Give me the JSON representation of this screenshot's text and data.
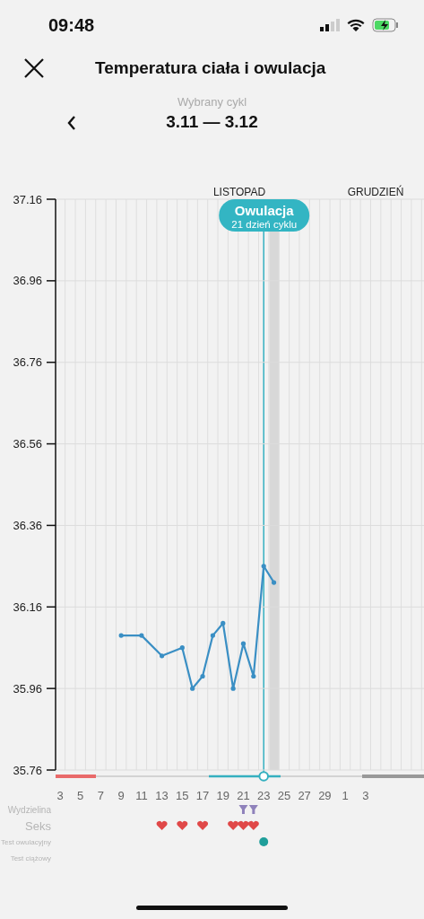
{
  "status_bar": {
    "time": "09:48"
  },
  "header": {
    "title": "Temperatura ciała i owulacja"
  },
  "cycle": {
    "label": "Wybrany cykl",
    "range": "3.11 — 3.12"
  },
  "months": [
    "LISTOPAD",
    "GRUDZIEŃ"
  ],
  "ovulation": {
    "title": "Owulacja",
    "subtitle": "21 dzień cyklu"
  },
  "chart_data": {
    "type": "line",
    "categories": [
      "3",
      null,
      "5",
      null,
      "7",
      null,
      "9",
      null,
      "11",
      null,
      "13",
      null,
      "15",
      null,
      "17",
      null,
      "19",
      null,
      "21",
      null,
      "23",
      null,
      "25",
      null,
      "27",
      null,
      "29",
      null,
      "1",
      null,
      "3"
    ],
    "series": [
      {
        "color": "#3a8fc4",
        "values": [
          null,
          null,
          null,
          null,
          null,
          null,
          36.09,
          null,
          36.09,
          null,
          36.04,
          null,
          36.06,
          35.96,
          35.99,
          36.09,
          36.12,
          35.96,
          36.07,
          35.99,
          36.26,
          36.22,
          null,
          null,
          null,
          null,
          null,
          null,
          null,
          null,
          null
        ]
      }
    ],
    "ylim": [
      35.76,
      37.16
    ],
    "grid": true,
    "yticks": [
      {
        "value": 37.16,
        "label": "37.16"
      },
      {
        "value": 36.96,
        "label": "36.96"
      },
      {
        "value": 36.76,
        "label": "36.76"
      },
      {
        "value": 36.56,
        "label": "36.56"
      },
      {
        "value": 36.36,
        "label": "36.36"
      },
      {
        "value": 36.16,
        "label": "36.16"
      },
      {
        "value": 35.96,
        "label": "35.96"
      },
      {
        "value": 35.76,
        "label": "35.76"
      }
    ]
  },
  "events": [
    {
      "label": "Wydzielina",
      "kind": "discharge",
      "marks": [
        false,
        false,
        false,
        false,
        false,
        false,
        false,
        false,
        false,
        false,
        false,
        false,
        false,
        false,
        false,
        false,
        false,
        false,
        true,
        true,
        false,
        false,
        false,
        false,
        false,
        false,
        false,
        false,
        false,
        false,
        false
      ]
    },
    {
      "label": "Seks",
      "kind": "heart",
      "marks": [
        false,
        false,
        false,
        false,
        false,
        false,
        false,
        false,
        false,
        false,
        true,
        false,
        true,
        false,
        true,
        false,
        false,
        true,
        true,
        true,
        false,
        false,
        false,
        false,
        false,
        false,
        false,
        false,
        false,
        false,
        false
      ]
    },
    {
      "label": "Test owulacyjny",
      "kind": "dot",
      "marks": [
        false,
        false,
        false,
        false,
        false,
        false,
        false,
        false,
        false,
        false,
        false,
        false,
        false,
        false,
        false,
        false,
        false,
        false,
        false,
        false,
        true,
        false,
        false,
        false,
        false,
        false,
        false,
        false,
        false,
        false,
        false
      ]
    },
    {
      "label": "Test ciążowy",
      "kind": "dot",
      "marks": [
        false,
        false,
        false,
        false,
        false,
        false,
        false,
        false,
        false,
        false,
        false,
        false,
        false,
        false,
        false,
        false,
        false,
        false,
        false,
        false,
        false,
        false,
        false,
        false,
        false,
        false,
        false,
        false,
        false,
        false,
        false
      ]
    }
  ]
}
